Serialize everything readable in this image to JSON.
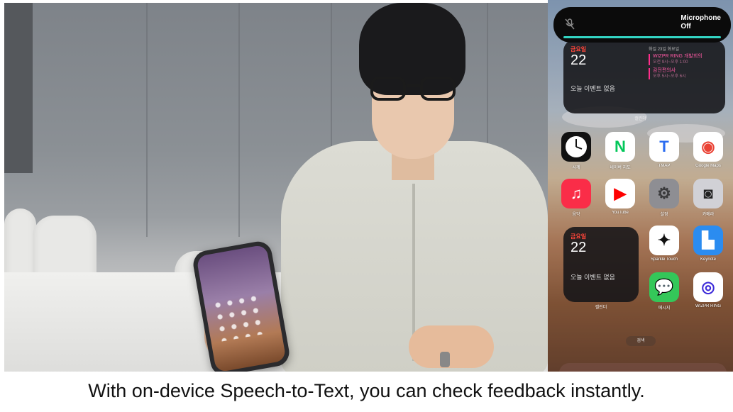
{
  "phone": {
    "island": {
      "mic_label_line1": "Microphone",
      "mic_label_line2": "Off",
      "mic_icon": "microphone-slash-icon",
      "accent": "#33d6c4"
    },
    "widget_top": {
      "day": "금요일",
      "date": "22",
      "no_events": "오늘 이벤트 없음",
      "side_header": "화일 23일 화요일",
      "events": [
        {
          "title": "WIZPR RING 개발회의",
          "time": "오전 9시~오후 1:00"
        },
        {
          "title": "감전편의사",
          "time": "오후 5시~오후 6시"
        }
      ]
    },
    "caption_calendar": "캘린더",
    "apps_row1": [
      {
        "icon": "clock-icon",
        "label": "시계"
      },
      {
        "icon": "naver-map-icon",
        "label": "네이버 지도"
      },
      {
        "icon": "tmap-icon",
        "label": "TMAP"
      },
      {
        "icon": "google-maps-icon",
        "label": "Google Maps"
      }
    ],
    "apps_row2": [
      {
        "icon": "music-icon",
        "label": "음악"
      },
      {
        "icon": "youtube-icon",
        "label": "YouTube"
      },
      {
        "icon": "settings-gear-icon",
        "label": "설정"
      },
      {
        "icon": "camera-icon",
        "label": "카메라"
      }
    ],
    "widget_mid": {
      "day": "금요일",
      "date": "22",
      "no_events": "오늘 이벤트 없음"
    },
    "caption_calendar_mid": "캘린더",
    "apps_right": [
      {
        "icon": "spark-icon",
        "label": "Sparkle Touch"
      },
      {
        "icon": "keynote-icon",
        "label": "Keynote"
      },
      {
        "icon": "messages-icon",
        "label": "메시지"
      },
      {
        "icon": "wizpr-ring-icon",
        "label": "WIZPR RING"
      }
    ],
    "search_label": "검색"
  },
  "subtitle": "With on-device Speech-to-Text, you can check feedback instantly."
}
